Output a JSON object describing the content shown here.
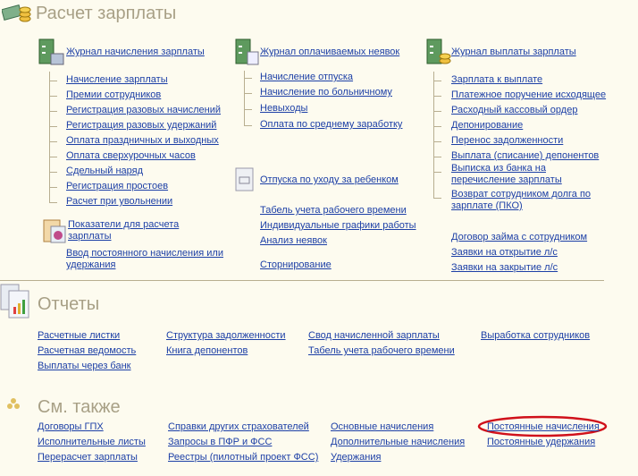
{
  "salary": {
    "title": "Расчет зарплаты",
    "col1": {
      "journal": "Журнал начисления зарплаты",
      "items": [
        "Начисление зарплаты",
        "Премии сотрудников",
        "Регистрация разовых начислений",
        "Регистрация разовых удержаний",
        "Оплата праздничных и выходных",
        "Оплата сверхурочных часов",
        "Сдельный наряд",
        "Регистрация простоев",
        "Расчет при увольнении"
      ],
      "indicators": "Показатели для расчета зарплаты",
      "permanent_entry": "Ввод постоянного начисления или удержания"
    },
    "col2": {
      "journal": "Журнал оплачиваемых неявок",
      "items": [
        "Начисление отпуска",
        "Начисление по больничному",
        "Невыходы",
        "Оплата по среднему заработку"
      ],
      "childcare": "Отпуска по уходу за ребенком",
      "links": [
        "Табель учета рабочего времени",
        "Индивидуальные графики работы",
        "Анализ неявок"
      ],
      "storno": "Сторнирование"
    },
    "col3": {
      "journal": "Журнал выплаты зарплаты",
      "items": [
        "Зарплата к выплате",
        "Платежное поручение исходящее",
        "Расходный кассовый ордер",
        "Депонирование",
        "Перенос задолженности",
        "Выплата (списание) депонентов",
        "Выписка из банка на перечисление зарплаты",
        "Возврат сотрудником долга по зарплате (ПКО)"
      ],
      "links": [
        "Договор займа с сотрудником",
        "Заявки на открытие л/с",
        "Заявки на закрытие л/с"
      ]
    }
  },
  "reports": {
    "title": "Отчеты",
    "cols": [
      [
        "Расчетные листки",
        "Расчетная ведомость",
        "Выплаты через банк"
      ],
      [
        "Структура задолженности",
        "Книга депонентов"
      ],
      [
        "Свод начисленной зарплаты",
        "Табель учета рабочего времени"
      ],
      [
        "Выработка сотрудников"
      ]
    ]
  },
  "see_also": {
    "title": "См. также",
    "cols": [
      [
        "Договоры ГПХ",
        "Исполнительные листы",
        "Перерасчет зарплаты"
      ],
      [
        "Справки других страхователей",
        "Запросы в ПФР и ФСС",
        "Реестры (пилотный проект ФСС)"
      ],
      [
        "Основные начисления",
        "Дополнительные начисления",
        "Удержания"
      ],
      [
        "Постоянные начисления",
        "Постоянные удержания"
      ]
    ],
    "highlighted": "Постоянные начисления",
    "highlight_color": "#d0101a"
  }
}
